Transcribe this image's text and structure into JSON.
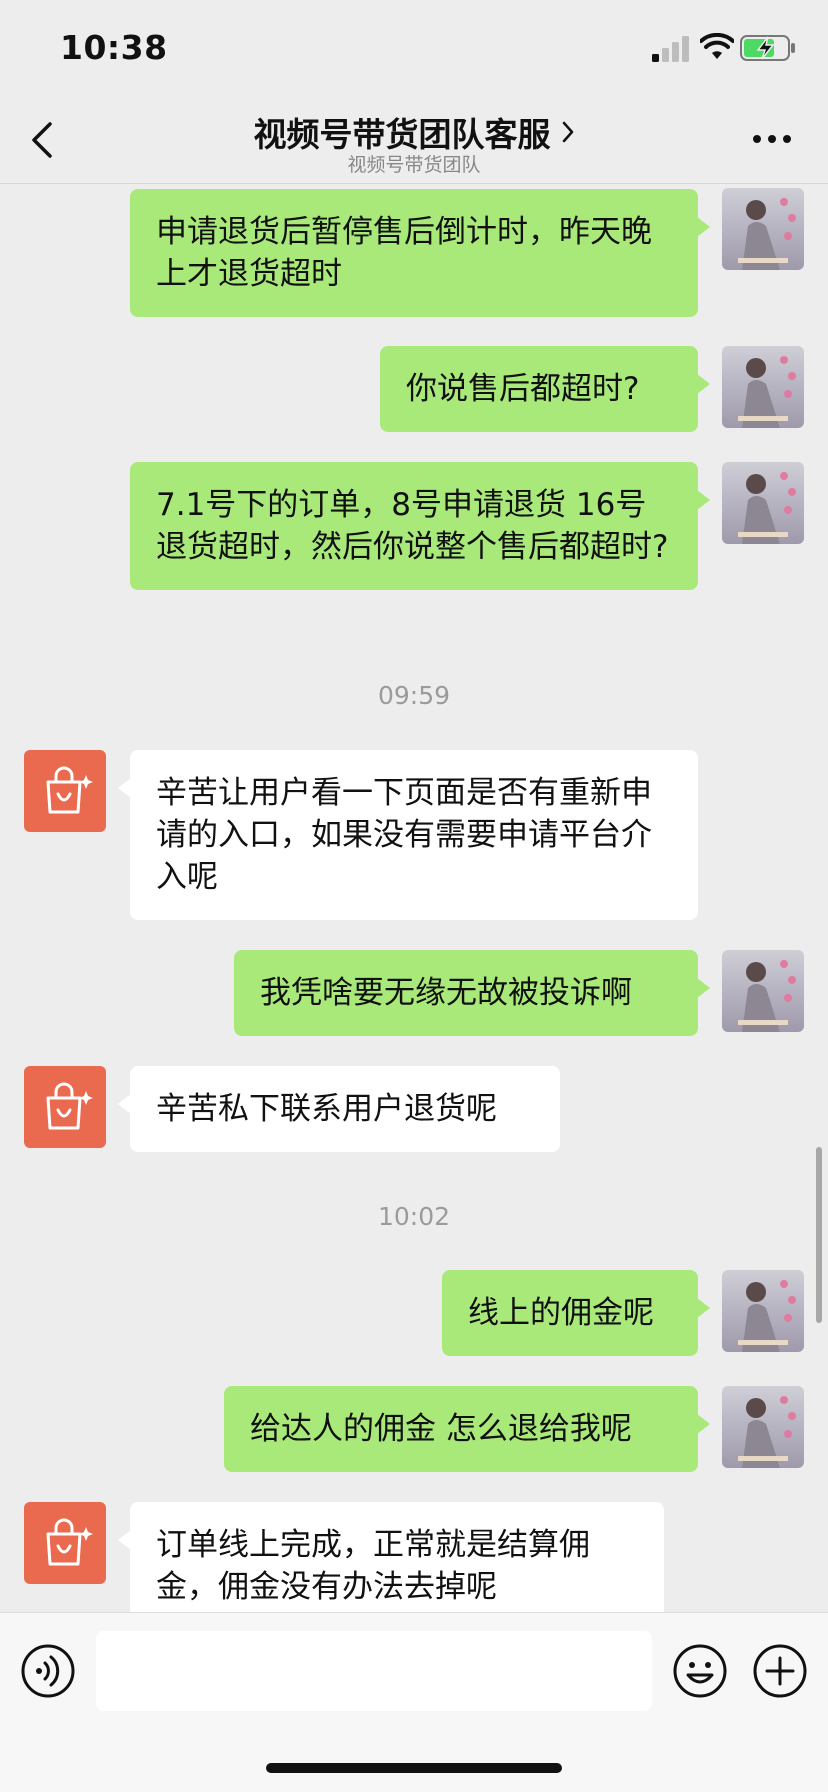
{
  "status_bar": {
    "time": "10:38"
  },
  "header": {
    "title": "视频号带货团队客服",
    "subtitle": "视频号带货团队"
  },
  "messages": [
    {
      "from": "me",
      "text": "申请退货后暂停售后倒计时，昨天晚上才退货超时"
    },
    {
      "from": "me",
      "text": "你说售后都超时?"
    },
    {
      "from": "me",
      "text": "7.1号下的订单，8号申请退货 16号退货超时，然后你说整个售后都超时?"
    },
    {
      "from": "them",
      "text": "辛苦让用户看一下页面是否有重新申请的入口，如果没有需要申请平台介入呢"
    },
    {
      "from": "me",
      "text": "我凭啥要无缘无故被投诉啊"
    },
    {
      "from": "them",
      "text": "辛苦私下联系用户退货呢"
    },
    {
      "from": "me",
      "text": "线上的佣金呢"
    },
    {
      "from": "me",
      "text": "给达人的佣金 怎么退给我呢"
    },
    {
      "from": "them",
      "text": "订单线上完成，正常就是结算佣金，佣金没有办法去掉呢"
    }
  ],
  "timestamps": [
    "09:59",
    "10:02"
  ],
  "input": {
    "value": "",
    "placeholder": ""
  },
  "icons": {
    "back": "back-chevron-icon",
    "more": "more-dots-icon",
    "voice": "voice-icon",
    "emoji": "emoji-icon",
    "plus": "plus-icon",
    "service_avatar": "shopping-bag-icon"
  },
  "colors": {
    "my_bubble": "#a9e97a",
    "their_bubble": "#ffffff",
    "service_avatar": "#ea6a4f",
    "background": "#ededed"
  }
}
